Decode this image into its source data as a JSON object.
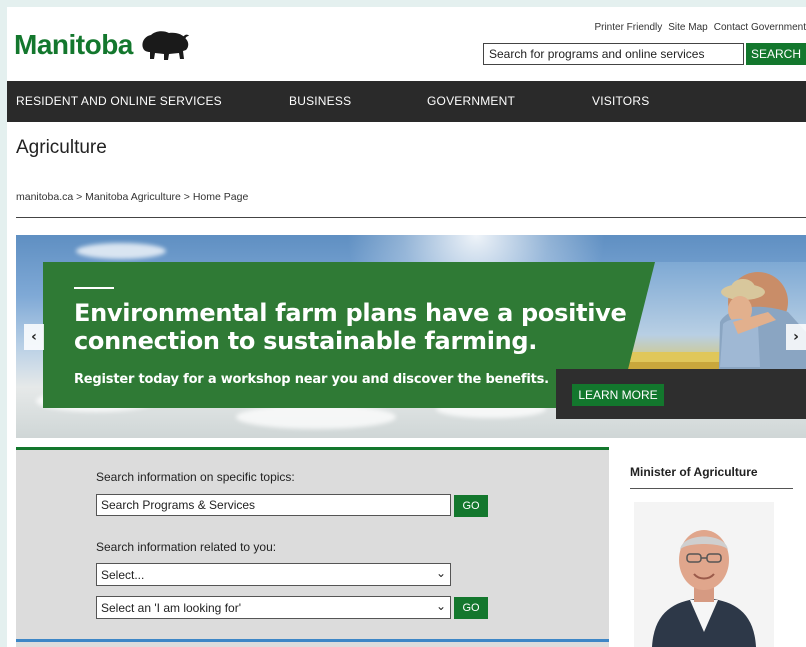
{
  "header": {
    "logo_text": "Manitoba",
    "util_links": [
      "Printer Friendly",
      "Site Map",
      "Contact Government"
    ],
    "search_placeholder": "Search for programs and online services",
    "search_button": "SEARCH"
  },
  "nav": {
    "items": [
      "RESIDENT AND ONLINE SERVICES",
      "BUSINESS",
      "GOVERNMENT",
      "VISITORS"
    ]
  },
  "page": {
    "title": "Agriculture",
    "breadcrumb": "manitoba.ca > Manitoba Agriculture > Home Page"
  },
  "banner": {
    "headline": "Environmental farm plans have a positive connection to sustainable farming.",
    "subline": "Register today for a workshop near you and discover the benefits.",
    "button": "LEARN MORE",
    "prev": "‹",
    "next": "›"
  },
  "search_panel": {
    "topics_label": "Search information on specific topics:",
    "topics_value": "Search Programs & Services",
    "go": "GO",
    "related_label": "Search information related to you:",
    "select_1": "Select...",
    "select_2": "Select an 'I am looking for'"
  },
  "sidebar": {
    "minister_title": "Minister of Agriculture"
  },
  "colors": {
    "brand_green": "#13772d",
    "nav_bg": "#2a2a2a",
    "panel_bg": "#dcdcdc",
    "accent_blue": "#3d86c6"
  }
}
